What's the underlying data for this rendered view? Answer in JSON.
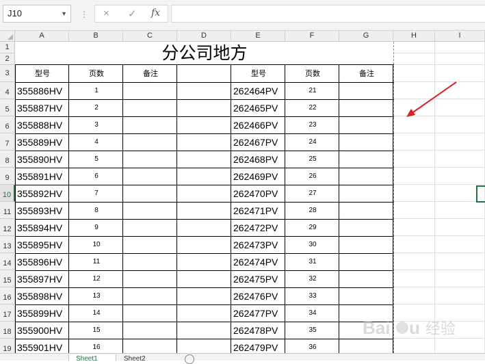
{
  "formula_bar": {
    "name_box": "J10",
    "cancel_glyph": "×",
    "enter_glyph": "✓",
    "fx_glyph": "fx",
    "formula": ""
  },
  "columns": [
    "A",
    "B",
    "C",
    "D",
    "E",
    "F",
    "G",
    "H",
    "I"
  ],
  "rows": [
    "1",
    "2",
    "3",
    "4",
    "5",
    "6",
    "7",
    "8",
    "9",
    "10",
    "11",
    "12",
    "13",
    "14",
    "15",
    "16",
    "17",
    "18",
    "19"
  ],
  "selected_cell": "J10",
  "sheet": {
    "title": "分公司地方",
    "headers_left": [
      "型号",
      "页数",
      "备注"
    ],
    "headers_right": [
      "型号",
      "页数",
      "备注"
    ],
    "left_models": [
      "355886HV",
      "355887HV",
      "355888HV",
      "355889HV",
      "355890HV",
      "355891HV",
      "355892HV",
      "355893HV",
      "355894HV",
      "355895HV",
      "355896HV",
      "355897HV",
      "355898HV",
      "355899HV",
      "355900HV",
      "355901HV"
    ],
    "left_pages": [
      "1",
      "2",
      "3",
      "4",
      "5",
      "6",
      "7",
      "8",
      "9",
      "10",
      "11",
      "12",
      "13",
      "14",
      "15",
      "16"
    ],
    "right_models": [
      "262464PV",
      "262465PV",
      "262466PV",
      "262467PV",
      "262468PV",
      "262469PV",
      "262470PV",
      "262471PV",
      "262472PV",
      "262473PV",
      "262474PV",
      "262475PV",
      "262476PV",
      "262477PV",
      "262478PV",
      "262479PV"
    ],
    "right_pages": [
      "21",
      "22",
      "23",
      "24",
      "25",
      "26",
      "27",
      "28",
      "29",
      "30",
      "31",
      "32",
      "33",
      "34",
      "35",
      "36"
    ]
  },
  "tabs": [
    "Sheet1",
    "Sheet2"
  ],
  "colors": {
    "accent": "#217346",
    "arrow": "#e02020"
  },
  "watermark_text": "Baidu 经验"
}
